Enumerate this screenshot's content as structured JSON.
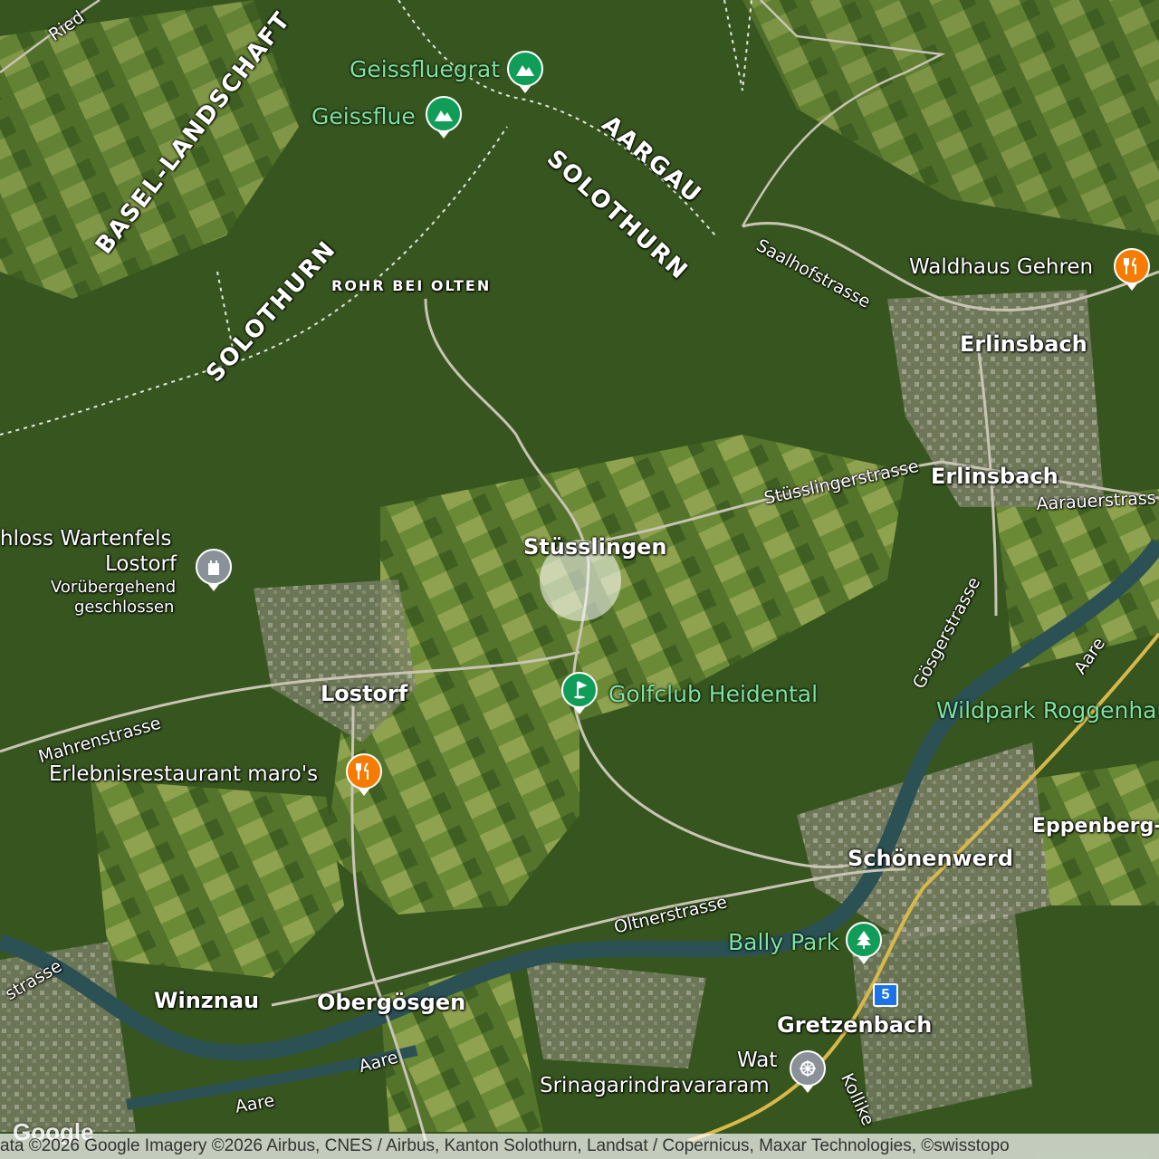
{
  "map": {
    "type": "satellite",
    "colors": {
      "forest": "#2f4a1f",
      "field": "#6f8f3a",
      "urban": "#8a8a7a",
      "river": "#2c5a5a",
      "poi_green": "#0f9d58",
      "poi_orange": "#f57c00",
      "poi_gray": "#8a9199"
    }
  },
  "regions": {
    "basel_landschaft": "BASEL-LANDSCHAFT",
    "solothurn_west": "SOLOTHURN",
    "solothurn_east": "SOLOTHURN",
    "aargau": "AARGAU",
    "rohr_bei_olten": "ROHR BEI OLTEN"
  },
  "towns": {
    "stusslingen": "Stüsslingen",
    "erlinsbach_1": "Erlinsbach",
    "erlinsbach_2": "Erlinsbach",
    "lostorf": "Lostorf",
    "schonenwerd": "Schönenwerd",
    "winznau": "Winznau",
    "obergosgen": "Obergösgen",
    "gretzenbach": "Gretzenbach",
    "eppenberg": "Eppenberg-",
    "ried": "Ried"
  },
  "streets": {
    "saalhofstrasse": "Saalhofstrasse",
    "stusslingerstrasse": "Stüsslingerstrasse",
    "aarauerstrasse": "Aarauerstrass",
    "gosgerstrasse": "Gösgerstrasse",
    "mahrenstrasse": "Mahrenstrasse",
    "oltnerstrasse": "Oltnerstrasse",
    "strasse_left": "strasse",
    "aare_1": "Aare",
    "aare_2": "Aare",
    "aare_3": "Aare",
    "kolliker": "Kollike"
  },
  "pois": {
    "geissfluegrat": {
      "label": "Geissfluegrat",
      "icon": "mountain-icon"
    },
    "geissflue": {
      "label": "Geissflue",
      "icon": "mountain-icon"
    },
    "waldhaus_gehren": {
      "label": "Waldhaus Gehren",
      "icon": "restaurant-icon"
    },
    "schloss_wartenfels": {
      "label": "hloss Wartenfels",
      "sub1": "Lostorf",
      "sub2": "Vorübergehend",
      "sub3": "geschlossen",
      "icon": "castle-icon"
    },
    "golfclub": {
      "label": "Golfclub Heidental",
      "icon": "golf-icon"
    },
    "wildpark": {
      "label": "Wildpark Roggenhau"
    },
    "erlebnisrestaurant": {
      "label": "Erlebnisrestaurant maro's",
      "icon": "restaurant-icon"
    },
    "bally_park": {
      "label": "Bally Park",
      "icon": "tree-icon"
    },
    "wat": {
      "label1": "Wat",
      "label2": "Srinagarindravararam",
      "icon": "dharma-wheel-icon"
    }
  },
  "route_shield": "5",
  "attribution": "ata ©2026 Google Imagery ©2026 Airbus, CNES / Airbus, Kanton Solothurn, Landsat / Copernicus, Maxar Technologies, ©swisstopo",
  "google_logo": "Google"
}
